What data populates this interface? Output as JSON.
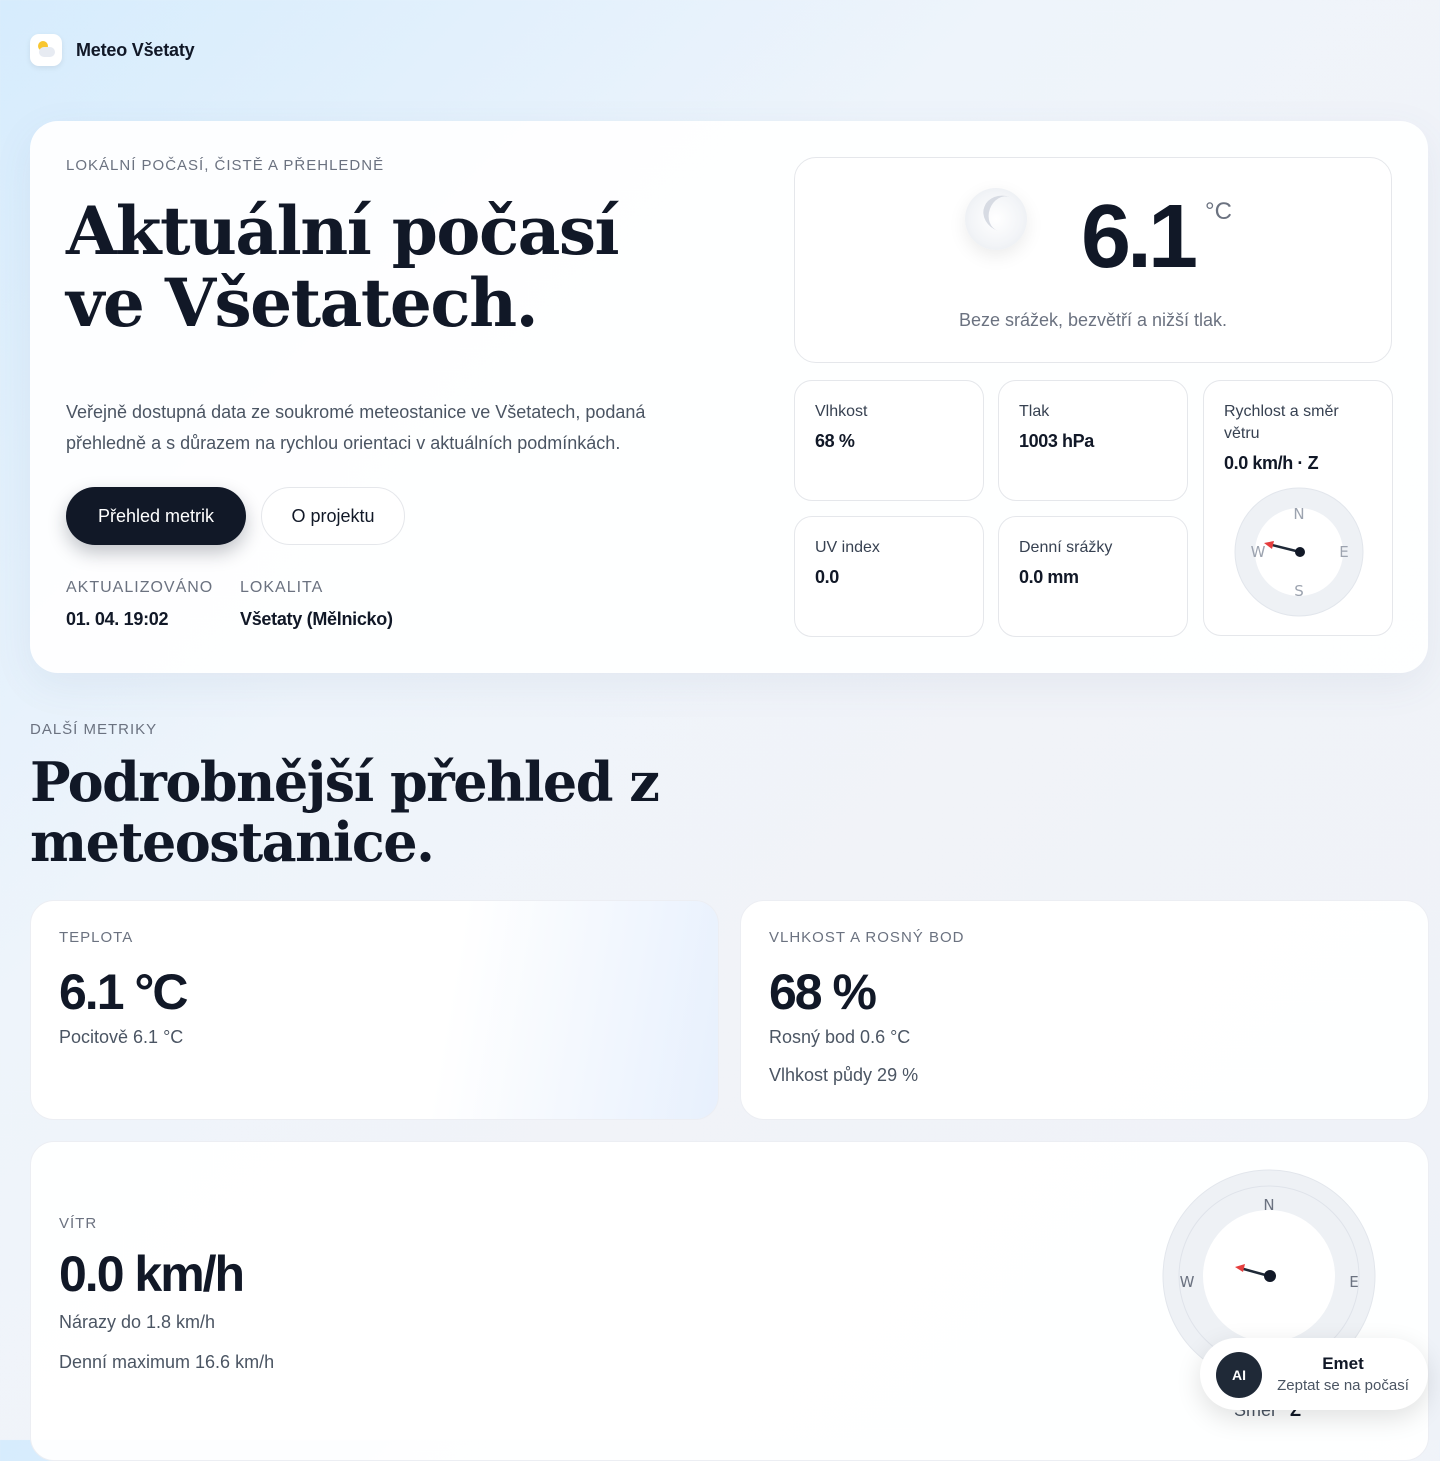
{
  "app": {
    "name": "Meteo Všetaty"
  },
  "hero": {
    "eyebrow": "LOKÁLNÍ POČASÍ, ČISTĚ A PŘEHLEDNĚ",
    "title_line1": "Aktuální počasí",
    "title_line2": "ve Všetatech.",
    "description": "Veřejně dostupná data ze soukromé meteostanice ve Všetatech, podaná přehledně a s důrazem na rychlou orientaci v aktuálních podmínkách.",
    "primary_button": "Přehled metrik",
    "secondary_button": "O projektu",
    "updated_label": "AKTUALIZOVÁNO",
    "updated_value": "01. 04. 19:02",
    "location_label": "LOKALITA",
    "location_value": "Všetaty (Mělnicko)"
  },
  "current": {
    "icon": "moon-icon",
    "temperature": "6.1",
    "unit": "°C",
    "summary": "Beze srážek, bezvětří a nižší tlak."
  },
  "tiles": {
    "humidity": {
      "label": "Vlhkost",
      "value": "68 %"
    },
    "pressure": {
      "label": "Tlak",
      "value": "1003 hPa"
    },
    "uv": {
      "label": "UV index",
      "value": "0.0"
    },
    "rain": {
      "label": "Denní srážky",
      "value": "0.0 mm"
    },
    "wind": {
      "label": "Rychlost a směr větru",
      "value": "0.0 km/h · Z",
      "direction_deg": 270
    }
  },
  "compass": {
    "n": "N",
    "e": "E",
    "s": "S",
    "w": "W"
  },
  "details": {
    "eyebrow": "DALŠÍ METRIKY",
    "title_line1": "Podrobnější přehled z",
    "title_line2": "meteostanice.",
    "temperature": {
      "eyebrow": "TEPLOTA",
      "value": "6.1 °C",
      "sub1": "Pocitově 6.1 °C"
    },
    "humidity": {
      "eyebrow": "VLHKOST A ROSNÝ BOD",
      "value": "68 %",
      "sub1": "Rosný bod 0.6 °C",
      "sub2": "Vlhkost půdy 29 %"
    },
    "wind": {
      "eyebrow": "VÍTR",
      "value": "0.0 km/h",
      "sub1": "Nárazy do 1.8 km/h",
      "sub2": "Denní maximum 16.6 km/h",
      "direction_label": "Směr",
      "direction_value": "Z",
      "direction_deg": 270
    }
  },
  "chat": {
    "avatar": "AI",
    "name": "Emet",
    "subtitle": "Zeptat se na počasí"
  },
  "colors": {
    "accent": "#111827",
    "needle": "#e53e3e"
  }
}
